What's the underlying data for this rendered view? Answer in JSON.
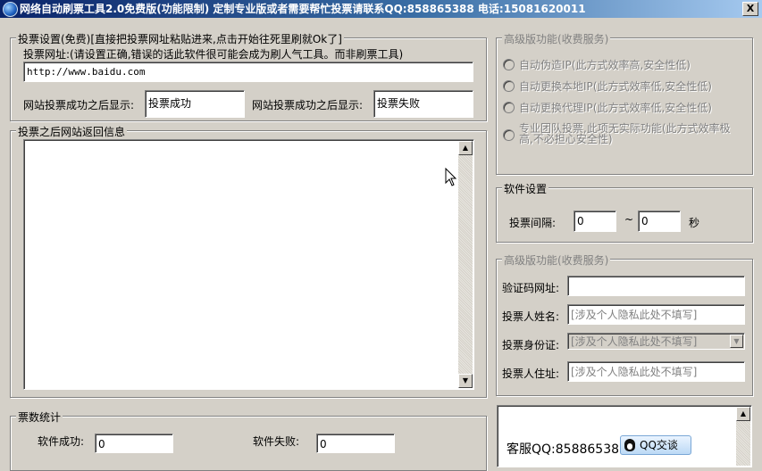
{
  "window": {
    "title": "网络自动刷票工具2.0免费版(功能限制)    定制专业版或者需要帮忙投票请联系QQ:858865388   电话:15081620011",
    "close_glyph": "X"
  },
  "vote_settings": {
    "legend": "投票设置(免费)[直接把投票网址粘贴进来,点击开始往死里刷就Ok了]",
    "url_label": "投票网址:(请设置正确,错误的话此软件很可能会成为刷人气工具。而非刷票工具)",
    "url_value": "http://www.baidu.com",
    "success_label": "网站投票成功之后显示:",
    "success_value": "投票成功",
    "fail_label": "网站投票成功之后显示:",
    "fail_value": "投票失败"
  },
  "response_panel": {
    "legend": "投票之后网站返回信息",
    "content": ""
  },
  "premium_options": {
    "legend": "高级版功能(收费服务)",
    "options": [
      "自动伪造IP(此方式效率高,安全性低)",
      "自动更换本地IP(此方式效率低,安全性低)",
      "自动更换代理IP(此方式效率低,安全性低)",
      "专业团队投票,此项无实际功能(此方式效率极高,不必担心安全性)"
    ]
  },
  "software_settings": {
    "legend": "软件设置",
    "interval_label": "投票间隔:",
    "interval_min": "0",
    "tilde": "~",
    "interval_max": "0",
    "unit": "秒"
  },
  "premium_fields": {
    "legend": "高级版功能(收费服务)",
    "captcha_label": "验证码网址:",
    "captcha_value": "",
    "name_label": "投票人姓名:",
    "name_placeholder": "[涉及个人隐私此处不填写]",
    "id_label": "投票身份证:",
    "id_placeholder": "[涉及个人隐私此处不填写]",
    "address_label": "投票人住址:",
    "address_placeholder": "[涉及个人隐私此处不填写]"
  },
  "stats": {
    "legend": "票数统计",
    "success_label": "软件成功:",
    "success_value": "0",
    "fail_label": "软件失败:",
    "fail_value": "0"
  },
  "support": {
    "text": "客服QQ:858865388",
    "button_label": "QQ交谈"
  }
}
